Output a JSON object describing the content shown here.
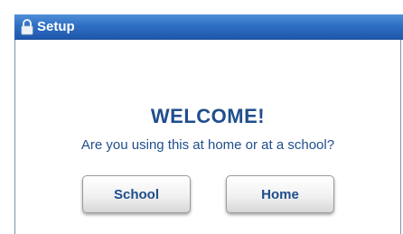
{
  "window": {
    "title": "Setup",
    "title_icon": "lock-icon"
  },
  "content": {
    "welcome": "WELCOME!",
    "question": "Are you using this at home or at a school?"
  },
  "buttons": {
    "school_label": "School",
    "home_label": "Home"
  },
  "colors": {
    "titlebar": "#2f6fc3",
    "text": "#1f4e8c",
    "button_face": "#f1f1f1"
  }
}
